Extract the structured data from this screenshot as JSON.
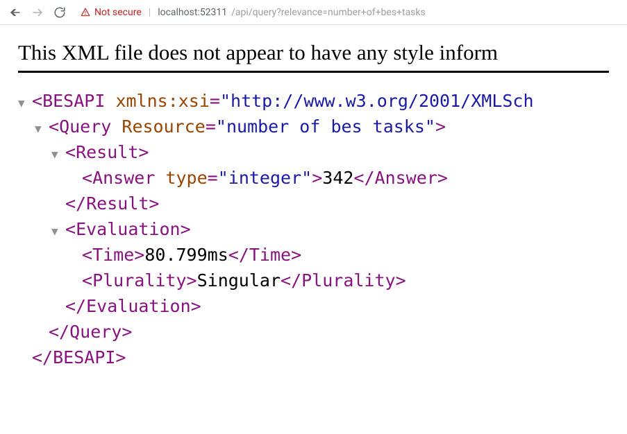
{
  "toolbar": {
    "not_secure_label": "Not secure",
    "url_host": "localhost:52311",
    "url_path": "/api/query?relevance=number+of+bes+tasks"
  },
  "banner": {
    "text": "This XML file does not appear to have any style inform"
  },
  "xml": {
    "root_tag": "BESAPI",
    "xmlns_attr": "xmlns:xsi",
    "xmlns_val_visible": "http://www.w3.org/2001/XMLSch",
    "query_tag": "Query",
    "query_attr": "Resource",
    "query_attr_val": "number of bes tasks",
    "result_tag": "Result",
    "answer_tag": "Answer",
    "answer_attr": "type",
    "answer_attr_val": "integer",
    "answer_text": "342",
    "eval_tag": "Evaluation",
    "time_tag": "Time",
    "time_text": "80.799ms",
    "plurality_tag": "Plurality",
    "plurality_text": "Singular"
  }
}
